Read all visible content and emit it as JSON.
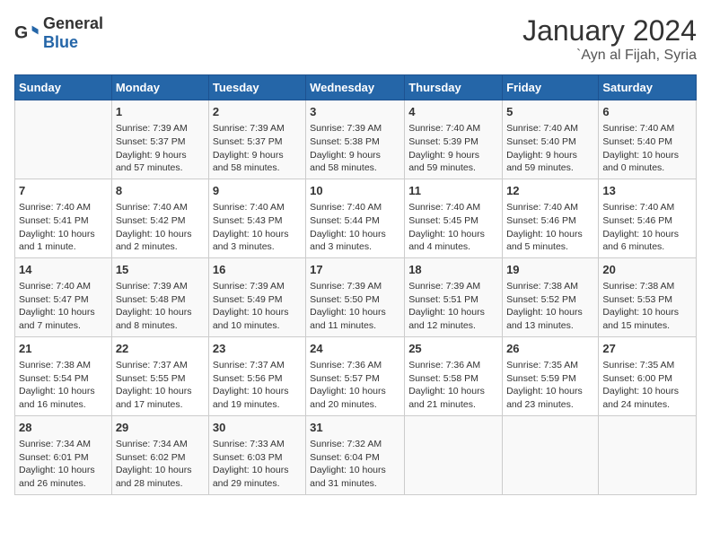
{
  "header": {
    "logo_general": "General",
    "logo_blue": "Blue",
    "title": "January 2024",
    "subtitle": "`Ayn al Fijah, Syria"
  },
  "days_of_week": [
    "Sunday",
    "Monday",
    "Tuesday",
    "Wednesday",
    "Thursday",
    "Friday",
    "Saturday"
  ],
  "weeks": [
    [
      {
        "day": "",
        "content": ""
      },
      {
        "day": "1",
        "content": "Sunrise: 7:39 AM\nSunset: 5:37 PM\nDaylight: 9 hours\nand 57 minutes."
      },
      {
        "day": "2",
        "content": "Sunrise: 7:39 AM\nSunset: 5:37 PM\nDaylight: 9 hours\nand 58 minutes."
      },
      {
        "day": "3",
        "content": "Sunrise: 7:39 AM\nSunset: 5:38 PM\nDaylight: 9 hours\nand 58 minutes."
      },
      {
        "day": "4",
        "content": "Sunrise: 7:40 AM\nSunset: 5:39 PM\nDaylight: 9 hours\nand 59 minutes."
      },
      {
        "day": "5",
        "content": "Sunrise: 7:40 AM\nSunset: 5:40 PM\nDaylight: 9 hours\nand 59 minutes."
      },
      {
        "day": "6",
        "content": "Sunrise: 7:40 AM\nSunset: 5:40 PM\nDaylight: 10 hours\nand 0 minutes."
      }
    ],
    [
      {
        "day": "7",
        "content": "Sunrise: 7:40 AM\nSunset: 5:41 PM\nDaylight: 10 hours\nand 1 minute."
      },
      {
        "day": "8",
        "content": "Sunrise: 7:40 AM\nSunset: 5:42 PM\nDaylight: 10 hours\nand 2 minutes."
      },
      {
        "day": "9",
        "content": "Sunrise: 7:40 AM\nSunset: 5:43 PM\nDaylight: 10 hours\nand 3 minutes."
      },
      {
        "day": "10",
        "content": "Sunrise: 7:40 AM\nSunset: 5:44 PM\nDaylight: 10 hours\nand 3 minutes."
      },
      {
        "day": "11",
        "content": "Sunrise: 7:40 AM\nSunset: 5:45 PM\nDaylight: 10 hours\nand 4 minutes."
      },
      {
        "day": "12",
        "content": "Sunrise: 7:40 AM\nSunset: 5:46 PM\nDaylight: 10 hours\nand 5 minutes."
      },
      {
        "day": "13",
        "content": "Sunrise: 7:40 AM\nSunset: 5:46 PM\nDaylight: 10 hours\nand 6 minutes."
      }
    ],
    [
      {
        "day": "14",
        "content": "Sunrise: 7:40 AM\nSunset: 5:47 PM\nDaylight: 10 hours\nand 7 minutes."
      },
      {
        "day": "15",
        "content": "Sunrise: 7:39 AM\nSunset: 5:48 PM\nDaylight: 10 hours\nand 8 minutes."
      },
      {
        "day": "16",
        "content": "Sunrise: 7:39 AM\nSunset: 5:49 PM\nDaylight: 10 hours\nand 10 minutes."
      },
      {
        "day": "17",
        "content": "Sunrise: 7:39 AM\nSunset: 5:50 PM\nDaylight: 10 hours\nand 11 minutes."
      },
      {
        "day": "18",
        "content": "Sunrise: 7:39 AM\nSunset: 5:51 PM\nDaylight: 10 hours\nand 12 minutes."
      },
      {
        "day": "19",
        "content": "Sunrise: 7:38 AM\nSunset: 5:52 PM\nDaylight: 10 hours\nand 13 minutes."
      },
      {
        "day": "20",
        "content": "Sunrise: 7:38 AM\nSunset: 5:53 PM\nDaylight: 10 hours\nand 15 minutes."
      }
    ],
    [
      {
        "day": "21",
        "content": "Sunrise: 7:38 AM\nSunset: 5:54 PM\nDaylight: 10 hours\nand 16 minutes."
      },
      {
        "day": "22",
        "content": "Sunrise: 7:37 AM\nSunset: 5:55 PM\nDaylight: 10 hours\nand 17 minutes."
      },
      {
        "day": "23",
        "content": "Sunrise: 7:37 AM\nSunset: 5:56 PM\nDaylight: 10 hours\nand 19 minutes."
      },
      {
        "day": "24",
        "content": "Sunrise: 7:36 AM\nSunset: 5:57 PM\nDaylight: 10 hours\nand 20 minutes."
      },
      {
        "day": "25",
        "content": "Sunrise: 7:36 AM\nSunset: 5:58 PM\nDaylight: 10 hours\nand 21 minutes."
      },
      {
        "day": "26",
        "content": "Sunrise: 7:35 AM\nSunset: 5:59 PM\nDaylight: 10 hours\nand 23 minutes."
      },
      {
        "day": "27",
        "content": "Sunrise: 7:35 AM\nSunset: 6:00 PM\nDaylight: 10 hours\nand 24 minutes."
      }
    ],
    [
      {
        "day": "28",
        "content": "Sunrise: 7:34 AM\nSunset: 6:01 PM\nDaylight: 10 hours\nand 26 minutes."
      },
      {
        "day": "29",
        "content": "Sunrise: 7:34 AM\nSunset: 6:02 PM\nDaylight: 10 hours\nand 28 minutes."
      },
      {
        "day": "30",
        "content": "Sunrise: 7:33 AM\nSunset: 6:03 PM\nDaylight: 10 hours\nand 29 minutes."
      },
      {
        "day": "31",
        "content": "Sunrise: 7:32 AM\nSunset: 6:04 PM\nDaylight: 10 hours\nand 31 minutes."
      },
      {
        "day": "",
        "content": ""
      },
      {
        "day": "",
        "content": ""
      },
      {
        "day": "",
        "content": ""
      }
    ]
  ]
}
